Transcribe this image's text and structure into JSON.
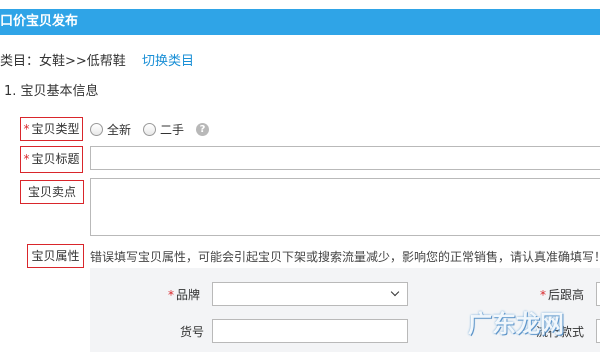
{
  "header": {
    "title": "口价宝贝发布"
  },
  "category": {
    "text": "类目：女鞋>>低帮鞋",
    "switch_label": "切换类目"
  },
  "section": {
    "title": "1. 宝贝基本信息"
  },
  "fields": {
    "type": {
      "required": "*",
      "label": "宝贝类型",
      "options": [
        "全新",
        "二手"
      ],
      "help": "?"
    },
    "title": {
      "required": "*",
      "label": "宝贝标题",
      "value": ""
    },
    "selling_point": {
      "label": "宝贝卖点",
      "value": ""
    },
    "attributes": {
      "label": "宝贝属性",
      "warning": "错误填写宝贝属性，可能会引起宝贝下架或搜索流量减少，影响您的正常销售，请认真准确填写！",
      "brand": {
        "required": "*",
        "label": "品牌",
        "value": ""
      },
      "item_no": {
        "label": "货号",
        "value": ""
      },
      "heel_height": {
        "required": "*",
        "label": "后跟高"
      },
      "style": {
        "label": "流行款式"
      }
    }
  },
  "watermark": "广东龙网"
}
